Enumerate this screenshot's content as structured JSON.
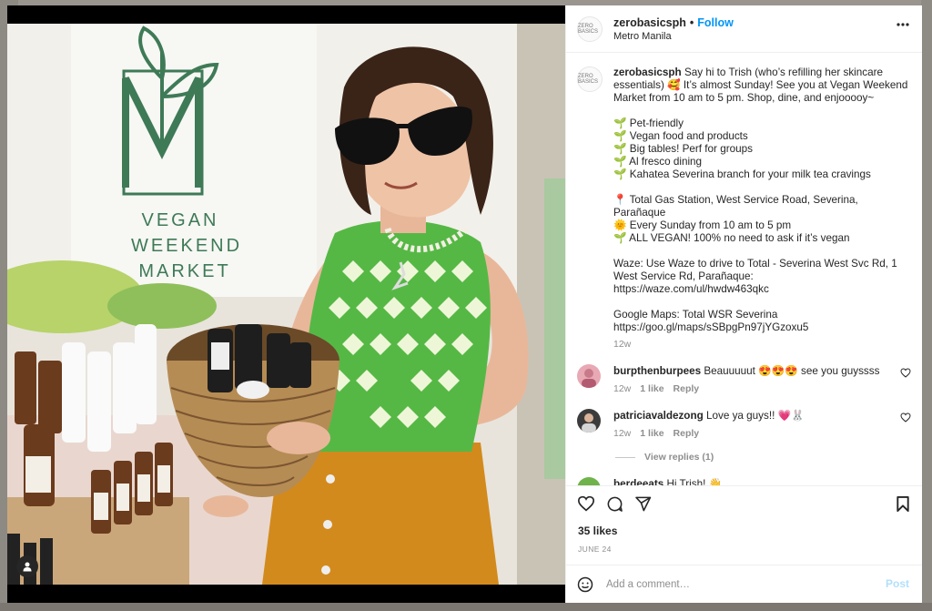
{
  "header": {
    "username": "zerobasicsph",
    "separator": "•",
    "follow_label": "Follow",
    "location": "Metro Manila",
    "avatar_text": "ZERO BASICS",
    "more_icon": "more-horizontal-icon"
  },
  "photo": {
    "sign_text_1": "VEGAN",
    "sign_text_2": "WEEKEND",
    "sign_text_3": "MARKET"
  },
  "caption": {
    "username": "zerobasicsph",
    "text": "Say hi to Trish (who’s refilling her skincare essentials) 🥰 It’s almost Sunday! See you at Vegan Weekend Market from 10 am to 5 pm. Shop, dine, and enjooooy~\n\n🌱 Pet-friendly\n🌱 Vegan food and products\n🌱 Big tables! Perf for groups\n🌱 Al fresco dining\n🌱 Kahatea Severina branch for your milk tea cravings\n\n📍 Total Gas Station, West Service Road, Severina, Parañaque\n🌞 Every Sunday from 10 am to 5 pm\n🌱 ALL VEGAN! 100% no need to ask if it’s vegan\n\nWaze: Use Waze to drive to Total - Severina West Svc Rd, 1 West Service Rd, Parañaque:\nhttps://waze.com/ul/hwdw463qkc\n\nGoogle Maps: Total WSR Severina\nhttps://goo.gl/maps/sSBpgPn97jYGzoxu5",
    "time": "12w"
  },
  "comments": [
    {
      "username": "burpthenburpees",
      "text": "Beauuuuut 😍😍😍 see you guyssss",
      "time": "12w",
      "likes": "1 like",
      "reply": "Reply"
    },
    {
      "username": "patriciavaldezong",
      "text": "Love ya guys!! 💗🐰",
      "time": "12w",
      "likes": "1 like",
      "reply": "Reply"
    },
    {
      "username": "berdeeats",
      "text": "Hi Trish! 👋"
    }
  ],
  "view_replies": "View replies (1)",
  "likes": "35 likes",
  "date": "JUNE 24",
  "add_comment": {
    "placeholder": "Add a comment…",
    "post_label": "Post"
  },
  "colors": {
    "follow": "#0095f6",
    "post_disabled": "#b2dffc",
    "muted": "#8e8e8e"
  }
}
